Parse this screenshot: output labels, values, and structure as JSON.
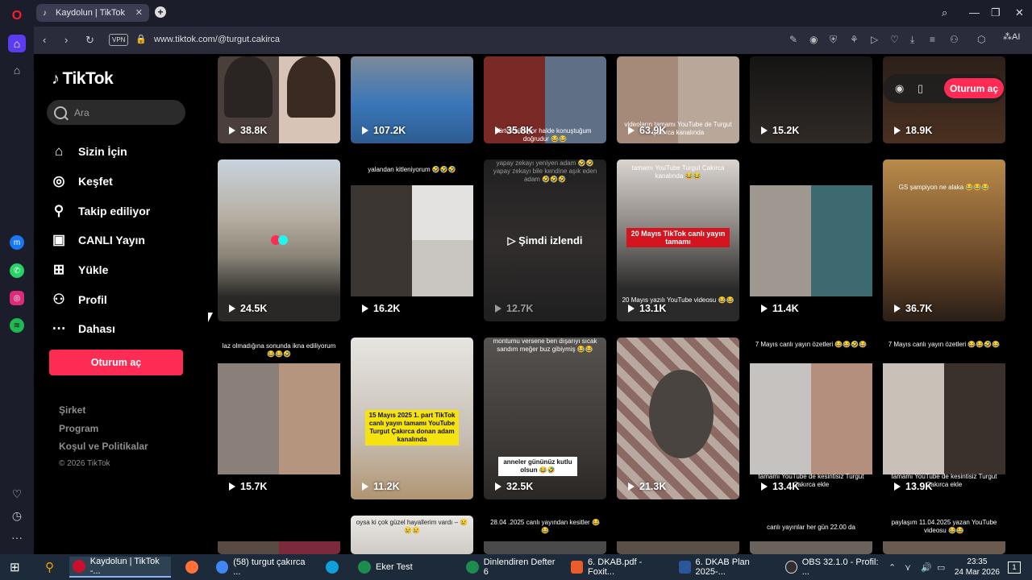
{
  "browser": {
    "tab_title": "Kaydolun | TikTok",
    "url": "www.tiktok.com/@turgut.cakirca",
    "vpn_label": "VPN",
    "ai_label": "AI"
  },
  "sidebar": {
    "logo": "TikTok",
    "search_placeholder": "Ara",
    "nav": [
      {
        "label": "Sizin İçin",
        "icon": "home-icon"
      },
      {
        "label": "Keşfet",
        "icon": "compass-icon"
      },
      {
        "label": "Takip ediliyor",
        "icon": "following-icon"
      },
      {
        "label": "CANLI Yayın",
        "icon": "live-icon"
      },
      {
        "label": "Yükle",
        "icon": "upload-icon"
      },
      {
        "label": "Profil",
        "icon": "profile-icon"
      },
      {
        "label": "Dahası",
        "icon": "more-icon"
      }
    ],
    "login_button": "Oturum aç",
    "footer": [
      "Şirket",
      "Program",
      "Koşul ve Politikalar"
    ],
    "copyright": "© 2026 TikTok"
  },
  "top_login": "Oturum aç",
  "videos": [
    {
      "views": "38.8K",
      "caption": ""
    },
    {
      "views": "107.2K",
      "caption": ""
    },
    {
      "views": "35.8K",
      "caption": "ürtçe bilmiyor halde konuştuğum doğrudur 😂😂"
    },
    {
      "views": "63.9K",
      "caption": "videoların tamamı YouTube de Turgut Çakırca kanalında"
    },
    {
      "views": "15.2K",
      "caption": ""
    },
    {
      "views": "18.9K",
      "caption": ""
    },
    {
      "views": "24.5K",
      "caption": ""
    },
    {
      "views": "16.2K",
      "caption": "yalandan kitleniyorum 🤣🤣🤣"
    },
    {
      "views": "12.7K",
      "caption": "yapay zekayı yeniyen adam 🤣🤣 yapay zekayı bile kendine aşık eden adam 🤣🤣🤣",
      "watched": "Şimdi izlendi"
    },
    {
      "views": "13.1K",
      "caption": "tamamı YouTube Turgut Çakırca kanalında 😂😂",
      "badge": "20 Mayıs TikTok canlı yayın tamamı",
      "bottom": "20 Mayıs yazılı YouTube videosu 😂😂"
    },
    {
      "views": "11.4K",
      "caption": ""
    },
    {
      "views": "36.7K",
      "caption": "GS şampiyon ne alaka 😂😂😂"
    },
    {
      "views": "15.7K",
      "caption": "laz olmadığına sonunda ikna ediliyorum 😂😂🤣"
    },
    {
      "views": "11.2K",
      "caption": "",
      "ybadge": "15 Mayıs 2025 1. part TikTok canlı yayın tamamı YouTube Turgut Çakırca donan adam kanalında"
    },
    {
      "views": "32.5K",
      "caption": "montumu versene ben dışarıyı sıcak sandım meğer buz gibiymiş 😂😂",
      "wbadge": "anneler gününüz kutlu olsun 😂🤣"
    },
    {
      "views": "21.3K",
      "caption": ""
    },
    {
      "views": "13.4K",
      "caption": "7 Mayıs canlı yayın özetleri 😂😂🤣😂",
      "bottom": "tamamı YouTube de kesintisiz Turgut Çakırca ekle"
    },
    {
      "views": "13.9K",
      "caption": "7 Mayıs canlı yayın özetleri 😂😂🤣😂",
      "bottom": "tamamı YouTube de kesintisiz Turgut Çakırca ekle"
    },
    {
      "views": "",
      "caption": ""
    },
    {
      "views": "",
      "caption": "oysa ki çok güzel hayallerim vardı – 😢😢😢"
    },
    {
      "views": "",
      "caption": "28.04 .2025 canlı yayından kesitler 😂😂"
    },
    {
      "views": "",
      "caption": ""
    },
    {
      "views": "",
      "caption": "canlı yayınlar her gün 22.00 da"
    },
    {
      "views": "",
      "caption": "paylaşım 11.04.2025 yazan YouTube videosu 😂😂"
    }
  ],
  "taskbar": {
    "items": [
      {
        "label": "Kaydolun | TikTok -...",
        "color": "#c8102e"
      },
      {
        "label": "",
        "color": "#ff7139"
      },
      {
        "label": "(58) turgut çakırca ...",
        "color": "#4285f4"
      },
      {
        "label": "",
        "color": "#0f9fd9"
      },
      {
        "label": "Eker Test",
        "color": "#1e8c4e"
      },
      {
        "label": "Dinlendiren Defter 6",
        "color": "#1e8c4e"
      },
      {
        "label": "6. DKAB.pdf - Foxit...",
        "color": "#e85d2a"
      },
      {
        "label": "6. DKAB Plan 2025-...",
        "color": "#2b579a"
      },
      {
        "label": "OBS 32.1.0 - Profil: ...",
        "color": "#302e31"
      }
    ],
    "time": "23:35",
    "date": "24 Mar 2026",
    "notif_count": "1"
  }
}
